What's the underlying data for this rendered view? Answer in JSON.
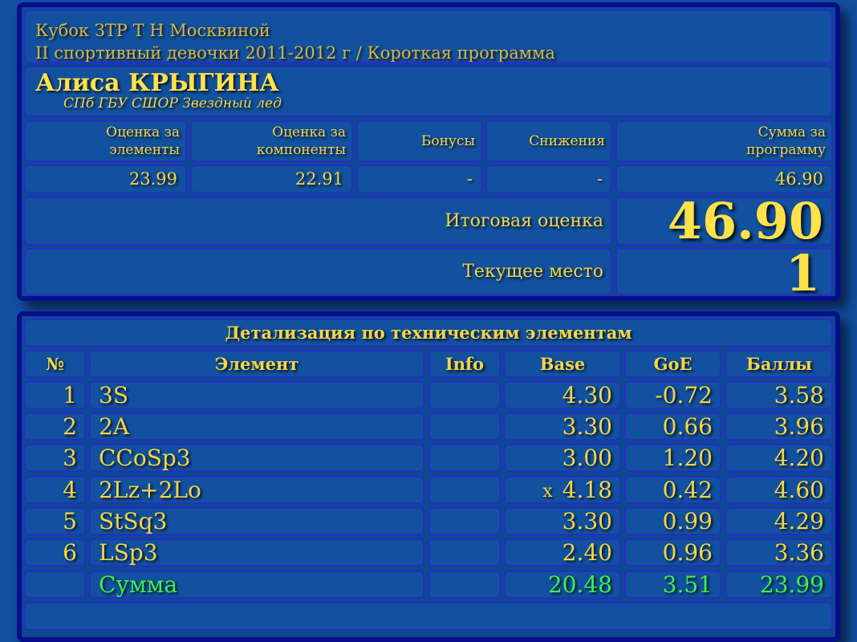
{
  "event": {
    "competition": "Кубок ЗТР Т Н Москвиной",
    "category": "II спортивный девочки 2011-2012 г / Короткая программа"
  },
  "athlete": {
    "name": "Алиса КРЫГИНА",
    "club": "СПб ГБУ СШОР Звездный лед"
  },
  "summary": {
    "headers": {
      "elements": "Оценка за элементы",
      "components": "Оценка за компоненты",
      "bonus": "Бонусы",
      "deductions": "Снижения",
      "total": "Сумма за программу"
    },
    "values": {
      "elements": "23.99",
      "components": "22.91",
      "bonus": "-",
      "deductions": "-",
      "total": "46.90"
    },
    "final_label": "Итоговая оценка",
    "final_value": "46.90",
    "place_label": "Текущее место",
    "place_value": "1"
  },
  "details": {
    "title": "Детализация по техническим элементам",
    "columns": [
      "№",
      "Элемент",
      "Info",
      "Base",
      "GoE",
      "Баллы"
    ],
    "rows": [
      {
        "no": "1",
        "element": "3S",
        "info": "",
        "mark": "",
        "base": "4.30",
        "goe": "-0.72",
        "points": "3.58"
      },
      {
        "no": "2",
        "element": "2A",
        "info": "",
        "mark": "",
        "base": "3.30",
        "goe": "0.66",
        "points": "3.96"
      },
      {
        "no": "3",
        "element": "CCoSp3",
        "info": "",
        "mark": "",
        "base": "3.00",
        "goe": "1.20",
        "points": "4.20"
      },
      {
        "no": "4",
        "element": "2Lz+2Lo",
        "info": "",
        "mark": "x",
        "base": "4.18",
        "goe": "0.42",
        "points": "4.60"
      },
      {
        "no": "5",
        "element": "StSq3",
        "info": "",
        "mark": "",
        "base": "3.30",
        "goe": "0.99",
        "points": "4.29"
      },
      {
        "no": "6",
        "element": "LSp3",
        "info": "",
        "mark": "",
        "base": "2.40",
        "goe": "0.96",
        "points": "3.36"
      }
    ],
    "total": {
      "label": "Сумма",
      "base": "20.48",
      "goe": "3.51",
      "points": "23.99"
    }
  },
  "colors": {
    "background": "#12509e",
    "panel_border": "#070d8c",
    "cell_bg": "#1251a0",
    "cell_border": "#2a2bc8",
    "text_yellow": "#f2d647",
    "text_gold": "#d9b642",
    "text_green": "#3df04b"
  }
}
